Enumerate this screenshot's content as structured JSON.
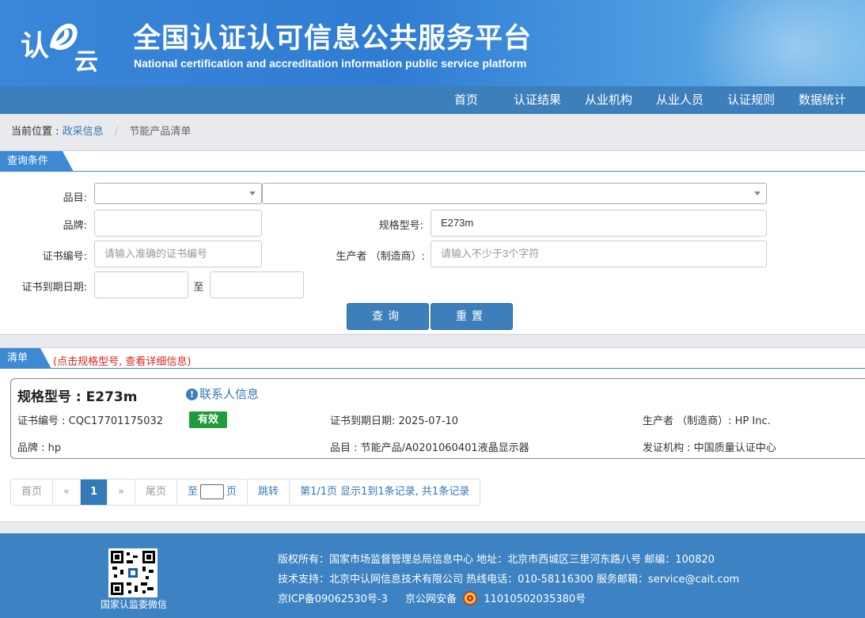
{
  "header": {
    "title": "全国认证认可信息公共服务平台",
    "subtitle": "National certification and accreditation information public service platform"
  },
  "nav": {
    "items": [
      "首页",
      "认证结果",
      "从业机构",
      "从业人员",
      "认证规则",
      "数据统计"
    ]
  },
  "breadcrumb": {
    "prefix": "当前位置 :",
    "link": "政采信息",
    "separator": "/",
    "current": "节能产品清单"
  },
  "query": {
    "tab_label": "查询条件",
    "category_label": "品目:",
    "brand_label": "品牌:",
    "model_label": "规格型号:",
    "model_value": "E273m",
    "cert_no_label": "证书编号:",
    "cert_no_placeholder": "请输入准确的证书编号",
    "producer_label": "生产者 （制造商）:",
    "producer_placeholder": "请输入不少于3个字符",
    "expiry_label": "证书到期日期:",
    "to_label": "至",
    "search_button": "查询",
    "reset_button": "重置"
  },
  "list": {
    "tab_label": "清单",
    "hint": "(点击规格型号, 查看详细信息)",
    "record": {
      "model": "规格型号 : E273m",
      "contact": "联系人信息",
      "cert_no": "证书编号 : CQC17701175032",
      "status": "有效",
      "status_color": "#1e9b3d",
      "expiry": "证书到期日期: 2025-07-10",
      "producer": "生产者 （制造商）: HP Inc.",
      "brand": "品牌 : hp",
      "category": "品目 : 节能产品/A0201060401液晶显示器",
      "issuer": "发证机构 : 中国质量认证中心"
    }
  },
  "pager": {
    "first": "首页",
    "prev": "«",
    "current": "1",
    "next": "»",
    "last": "尾页",
    "to": "至",
    "page_unit": "页",
    "jump": "跳转",
    "summary": "第1/1页 显示1到1条记录, 共1条记录"
  },
  "footer": {
    "qr_label": "国家认监委微信",
    "line1": "版权所有：国家市场监督管理总局信息中心   地址：北京市西城区三里河东路八号   邮编：100820",
    "line2": "技术支持：北京中认网信息技术有限公司   热线电话：010-58116300   服务邮箱：service@cait.com",
    "icp": "京ICP备09062530号-3",
    "police": "京公网安备",
    "police_no": "11010502035380号"
  },
  "colors": {
    "header_blue": "#2f7dd3",
    "nav_blue": "#3d7fbb",
    "link_blue": "#337ab7",
    "hint_red": "#e0241c",
    "footer_blue": "#3d82c2"
  }
}
